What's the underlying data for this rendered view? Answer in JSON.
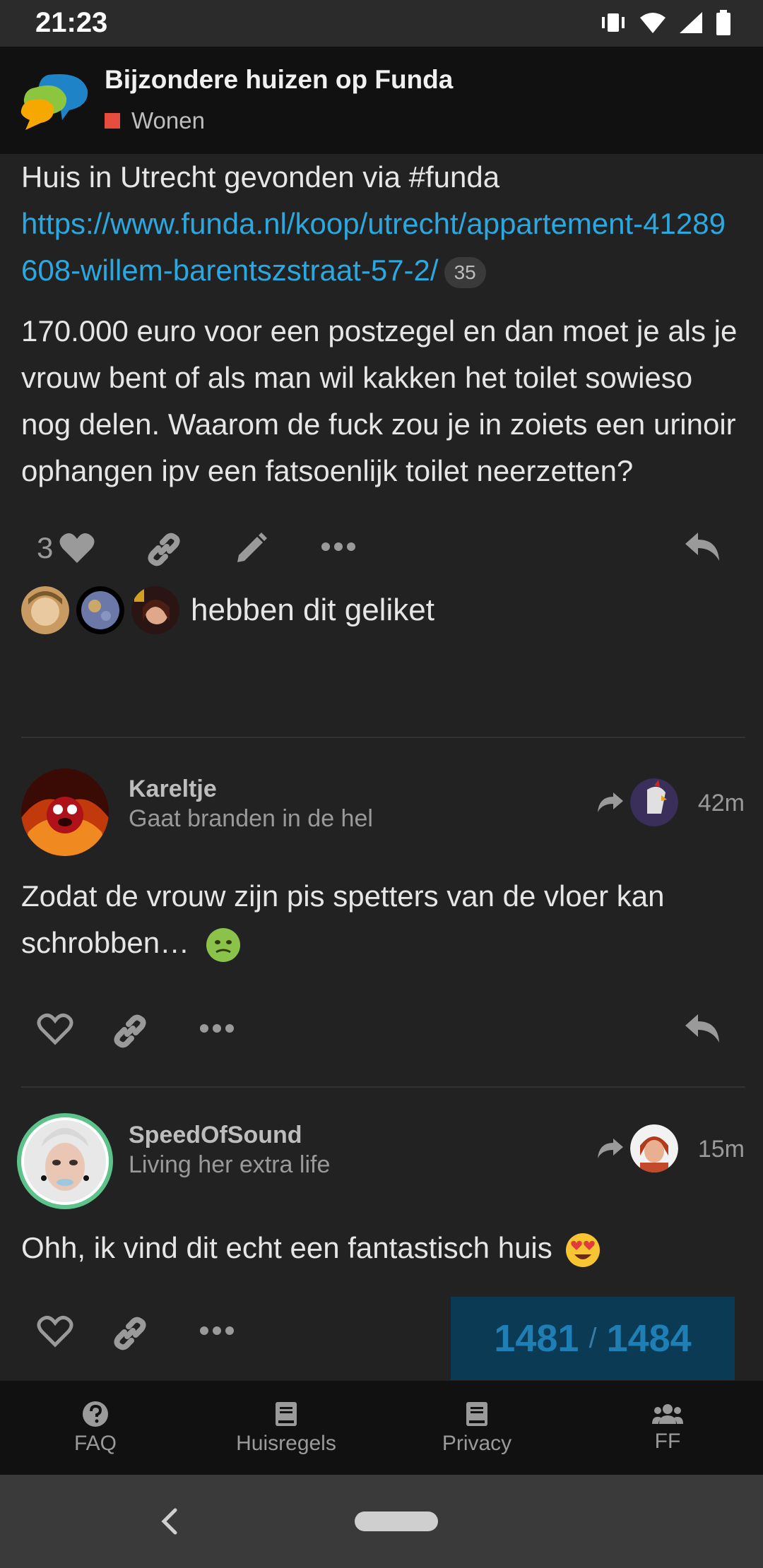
{
  "status_bar": {
    "time": "21:23"
  },
  "topic": {
    "title": "Bijzondere huizen op Funda",
    "category": "Wonen",
    "category_color": "#e74c3c"
  },
  "first_post": {
    "intro": "Huis in Utrecht gevonden via #funda",
    "link": "https://www.funda.nl/koop/utrecht/appartement-41289608-willem-barentszstraat-57-2/",
    "link_clicks": "35",
    "body": "170.000 euro voor een postzegel en dan moet je als je vrouw bent of als man wil kakken het toilet sowieso nog delen. Waarom de fuck zou je in zoiets een urinoir ophangen ipv een fatsoenlijk toilet neerzetten?",
    "like_count": "3",
    "liked_text": "hebben dit geliket"
  },
  "posts": [
    {
      "username": "Kareltje",
      "user_title": "Gaat branden in de hel",
      "age": "42m",
      "body": "Zodat de vrouw zijn pis spetters van de vloer kan schrobben…",
      "emoji": "nauseated-face-emoji"
    },
    {
      "username": "SpeedOfSound",
      "user_title": "Living her extra life",
      "age": "15m",
      "body": "Ohh, ik vind dit echt een fantastisch huis",
      "emoji": "heart-eyes-emoji"
    }
  ],
  "progress": {
    "current": "1481",
    "separator": "/",
    "total": "1484"
  },
  "footer": {
    "items": [
      {
        "label": "FAQ",
        "icon": "question-icon"
      },
      {
        "label": "Huisregels",
        "icon": "book-icon"
      },
      {
        "label": "Privacy",
        "icon": "book-icon"
      },
      {
        "label": "FF",
        "icon": "users-icon"
      }
    ]
  },
  "colors": {
    "accent": "#2aa8df",
    "background": "#222222",
    "header": "#111111"
  }
}
